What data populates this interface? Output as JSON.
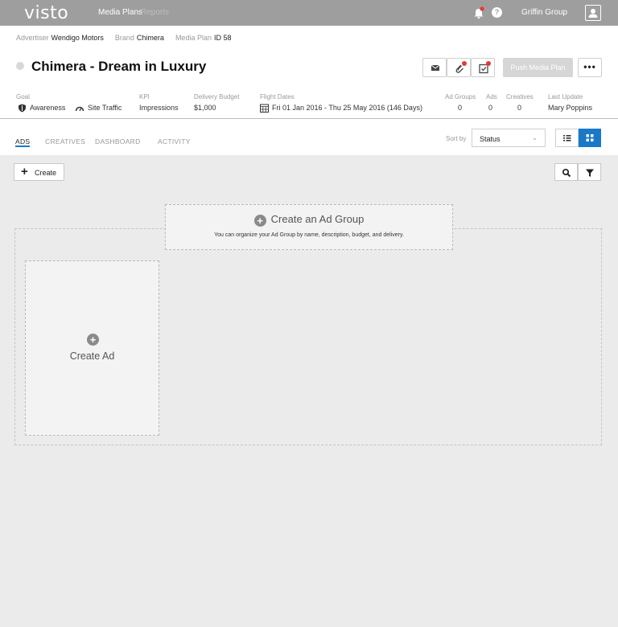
{
  "app": {
    "logo": "visto",
    "nav": [
      "Media Plans",
      "Reports"
    ],
    "account_name": "Griffin Group",
    "icons": [
      "bell-icon",
      "help-icon",
      "user-icon"
    ],
    "notification_color": "#e53935"
  },
  "breadcrumb": {
    "advertiser_label": "Advertiser",
    "advertiser_value": "Wendigo Motors",
    "brand_label": "Brand",
    "brand_value": "Chimera",
    "plan_label": "Media Plan",
    "plan_value": "ID 58"
  },
  "header": {
    "title": "Chimera - Dream in Luxury",
    "push_label": "Push Media Plan",
    "more_label": "•••",
    "action_icons": [
      "mail-icon",
      "attachment-icon",
      "checklist-icon"
    ]
  },
  "meta": {
    "goal_label": "Goal",
    "goal_1": "Awareness",
    "goal_2": "Site Traffic",
    "kpi_label": "KPI",
    "kpi_value": "Impressions",
    "budget_label": "Delivery Budget",
    "budget_value": "$1,000",
    "flight_label": "Flight Dates",
    "flight_value": "Fri 01 Jan 2016 - Thu 25 May 2016 (146 Days)",
    "ad_groups_label": "Ad Groups",
    "ad_groups_value": "0",
    "ads_label": "Ads",
    "ads_value": "0",
    "creatives_label": "Creatives",
    "creatives_value": "0",
    "last_update_label": "Last Update",
    "last_update_value": "Mary Poppins"
  },
  "tabs": [
    "ADS",
    "CREATIVES",
    "DASHBOARD",
    "ACTIVITY"
  ],
  "active_tab": "ADS",
  "sort": {
    "label": "Sort by",
    "value": "Status"
  },
  "toolbar": {
    "create_label": "Create",
    "search_icon": "search-icon",
    "filter_icon": "filter-icon"
  },
  "ad_group": {
    "title": "Create an Ad Group",
    "subtitle": "You can organize your Ad Group by name, description, budget, and delivery."
  },
  "ad_card": {
    "label": "Create Ad"
  },
  "colors": {
    "topbar": "#9e9e9e",
    "accent": "#1a79c7",
    "background": "#ebebeb"
  }
}
